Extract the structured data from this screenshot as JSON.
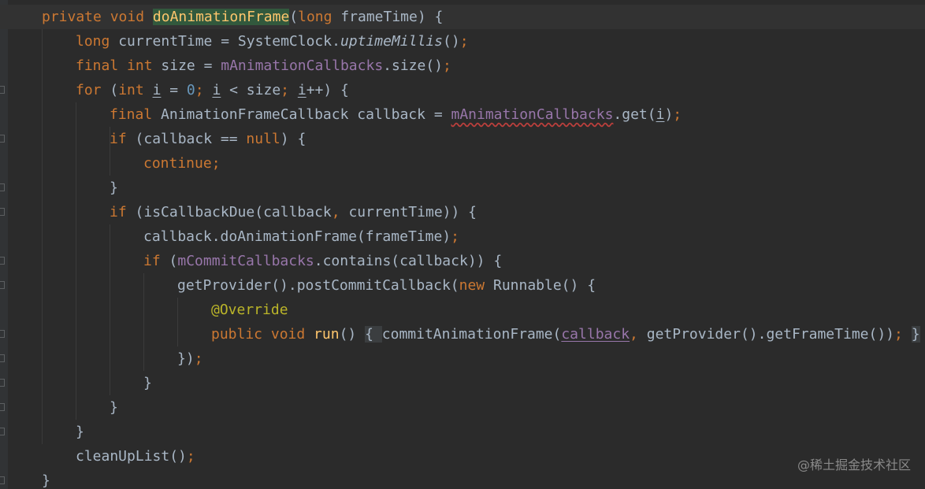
{
  "editor": {
    "theme_colors": {
      "background": "#2b2b2b",
      "default_text": "#a9b7c6",
      "keyword": "#cc7832",
      "function_declaration": "#ffc66d",
      "field": "#9876aa",
      "number": "#6897bb",
      "annotation": "#bbb529",
      "error_squiggle": "#bc3f3c",
      "current_line": "#323232"
    },
    "lines": [
      {
        "tokens": [
          {
            "t": "private ",
            "k": "kw"
          },
          {
            "t": "void ",
            "k": "kw"
          },
          {
            "t": "doAnimationFrame",
            "k": "fn ident-hl"
          },
          {
            "t": "(",
            "k": ""
          },
          {
            "t": "long ",
            "k": "kw"
          },
          {
            "t": "frameTime) {",
            "k": ""
          }
        ]
      },
      {
        "tokens": [
          {
            "t": "long ",
            "k": "kw"
          },
          {
            "t": "currentTime = SystemClock.",
            "k": ""
          },
          {
            "t": "uptimeMillis",
            "k": "it"
          },
          {
            "t": "()",
            "k": ""
          },
          {
            "t": ";",
            "k": "kw"
          }
        ]
      },
      {
        "tokens": [
          {
            "t": "final ",
            "k": "kw"
          },
          {
            "t": "int ",
            "k": "kw"
          },
          {
            "t": "size = ",
            "k": ""
          },
          {
            "t": "mAnimationCallbacks",
            "k": "fld"
          },
          {
            "t": ".size()",
            "k": ""
          },
          {
            "t": ";",
            "k": "kw"
          }
        ]
      },
      {
        "tokens": [
          {
            "t": "for ",
            "k": "kw"
          },
          {
            "t": "(",
            "k": ""
          },
          {
            "t": "int ",
            "k": "kw"
          },
          {
            "t": "i",
            "k": "u"
          },
          {
            "t": " = ",
            "k": ""
          },
          {
            "t": "0",
            "k": "num"
          },
          {
            "t": "; ",
            "k": "kw"
          },
          {
            "t": "i",
            "k": "u"
          },
          {
            "t": " < size",
            "k": ""
          },
          {
            "t": "; ",
            "k": "kw"
          },
          {
            "t": "i",
            "k": "u"
          },
          {
            "t": "++) {",
            "k": ""
          }
        ]
      },
      {
        "tokens": [
          {
            "t": "final ",
            "k": "kw"
          },
          {
            "t": "AnimationFrameCallback callback = ",
            "k": ""
          },
          {
            "t": "mAnimationCallbacks",
            "k": "fld sq"
          },
          {
            "t": ".get(",
            "k": ""
          },
          {
            "t": "i",
            "k": "u"
          },
          {
            "t": ")",
            "k": ""
          },
          {
            "t": ";",
            "k": "kw"
          }
        ]
      },
      {
        "tokens": [
          {
            "t": "if ",
            "k": "kw"
          },
          {
            "t": "(callback == ",
            "k": ""
          },
          {
            "t": "null",
            "k": "kw"
          },
          {
            "t": ") {",
            "k": ""
          }
        ]
      },
      {
        "tokens": [
          {
            "t": "continue;",
            "k": "kw"
          }
        ]
      },
      {
        "tokens": [
          {
            "t": "}",
            "k": ""
          }
        ]
      },
      {
        "tokens": [
          {
            "t": "if ",
            "k": "kw"
          },
          {
            "t": "(isCallbackDue(callback",
            "k": ""
          },
          {
            "t": ", ",
            "k": "kw"
          },
          {
            "t": "currentTime)) {",
            "k": ""
          }
        ]
      },
      {
        "tokens": [
          {
            "t": "callback.doAnimationFrame(frameTime)",
            "k": ""
          },
          {
            "t": ";",
            "k": "kw"
          }
        ]
      },
      {
        "tokens": [
          {
            "t": "if ",
            "k": "kw"
          },
          {
            "t": "(",
            "k": ""
          },
          {
            "t": "mCommitCallbacks",
            "k": "fld"
          },
          {
            "t": ".contains(callback)) {",
            "k": ""
          }
        ]
      },
      {
        "tokens": [
          {
            "t": "getProvider().postCommitCallback(",
            "k": ""
          },
          {
            "t": "new ",
            "k": "kw"
          },
          {
            "t": "Runnable() {",
            "k": ""
          }
        ]
      },
      {
        "tokens": [
          {
            "t": "@Override",
            "k": "ann"
          }
        ]
      },
      {
        "tokens": [
          {
            "t": "public ",
            "k": "kw"
          },
          {
            "t": "void ",
            "k": "kw"
          },
          {
            "t": "run",
            "k": "fn"
          },
          {
            "t": "() ",
            "k": ""
          },
          {
            "t": "{ ",
            "k": "fold-hl"
          },
          {
            "t": "commitAnimationFrame(",
            "k": ""
          },
          {
            "t": "callback",
            "k": "fld u"
          },
          {
            "t": ", ",
            "k": "kw"
          },
          {
            "t": "getProvider().getFrameTime())",
            "k": ""
          },
          {
            "t": "; ",
            "k": "kw"
          },
          {
            "t": "}",
            "k": "fold-hl"
          }
        ]
      },
      {
        "tokens": [
          {
            "t": "})",
            "k": ""
          },
          {
            "t": ";",
            "k": "kw"
          }
        ]
      },
      {
        "tokens": [
          {
            "t": "}",
            "k": ""
          }
        ]
      },
      {
        "tokens": [
          {
            "t": "}",
            "k": ""
          }
        ]
      },
      {
        "tokens": [
          {
            "t": "}",
            "k": ""
          }
        ]
      },
      {
        "tokens": [
          {
            "t": "cleanUpList()",
            "k": ""
          },
          {
            "t": ";",
            "k": "kw"
          }
        ]
      },
      {
        "tokens": [
          {
            "t": "}",
            "k": ""
          }
        ]
      }
    ]
  },
  "watermark": {
    "text": "@稀土掘金技术社区"
  }
}
